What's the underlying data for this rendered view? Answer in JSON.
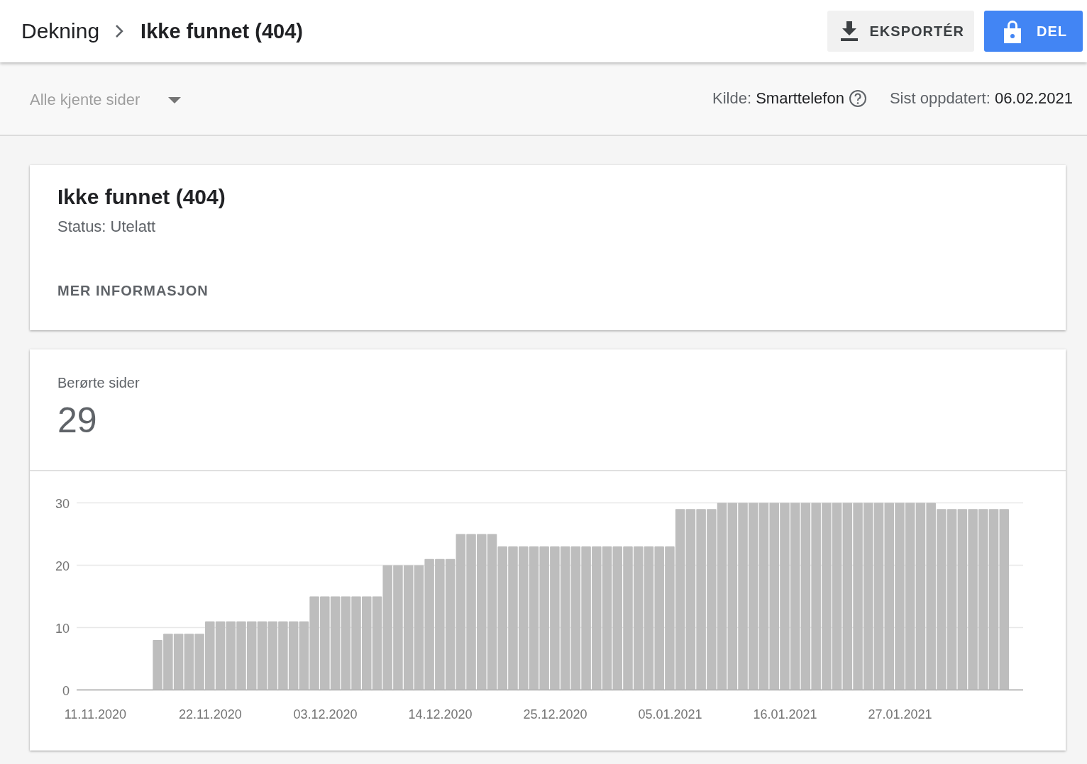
{
  "breadcrumb": [
    {
      "label": "Dekning"
    },
    {
      "label": "Ikke funnet (404)"
    }
  ],
  "actions": [
    {
      "kind": "export",
      "label": "EKSPORTÉR"
    },
    {
      "kind": "share",
      "label": "DEL"
    }
  ],
  "filter": {
    "dropdown": "Alle kjente sider",
    "source_label": "Kilde:",
    "source_value": "Smarttelefon",
    "updated_label": "Sist oppdatert:",
    "updated_value": "06.02.2021"
  },
  "issue_card": {
    "title": "Ikke funnet (404)",
    "status": "Status: Utelatt",
    "link": "MER INFORMASJON"
  },
  "pages_card": {
    "label": "Berørte sider",
    "count": "29",
    "chart_data": {
      "type": "bar",
      "ylim": [
        0,
        30
      ],
      "yticks": [
        0,
        10,
        20,
        30
      ],
      "categories": [
        "11.11.2020",
        null,
        null,
        null,
        null,
        null,
        null,
        null,
        null,
        null,
        null,
        "22.11.2020",
        null,
        null,
        null,
        null,
        null,
        null,
        null,
        null,
        null,
        null,
        "03.12.2020",
        null,
        null,
        null,
        null,
        null,
        null,
        null,
        null,
        null,
        null,
        "14.12.2020",
        null,
        null,
        null,
        null,
        null,
        null,
        null,
        null,
        null,
        null,
        "25.12.2020",
        null,
        null,
        null,
        null,
        null,
        null,
        null,
        null,
        null,
        null,
        "05.01.2021",
        null,
        null,
        null,
        null,
        null,
        null,
        null,
        null,
        null,
        null,
        "16.01.2021",
        null,
        null,
        null,
        null,
        null,
        null,
        null,
        null,
        null,
        null,
        "27.01.2021",
        null,
        null,
        null,
        null,
        null,
        null,
        null,
        null,
        null,
        null
      ],
      "series": [
        {
          "color": "#bdbdbd",
          "values": [
            null,
            null,
            null,
            null,
            null,
            null,
            8,
            9,
            9,
            9,
            9,
            11,
            11,
            11,
            11,
            11,
            11,
            11,
            11,
            11,
            11,
            15,
            15,
            15,
            15,
            15,
            15,
            15,
            20,
            20,
            20,
            20,
            21,
            21,
            21,
            25,
            25,
            25,
            25,
            23,
            23,
            23,
            23,
            23,
            23,
            23,
            23,
            23,
            23,
            23,
            23,
            23,
            23,
            23,
            23,
            23,
            29,
            29,
            29,
            29,
            30,
            30,
            30,
            30,
            30,
            30,
            30,
            30,
            30,
            30,
            30,
            30,
            30,
            30,
            30,
            30,
            30,
            30,
            30,
            30,
            30,
            29,
            29,
            29,
            29,
            29,
            29,
            29
          ]
        }
      ]
    }
  }
}
